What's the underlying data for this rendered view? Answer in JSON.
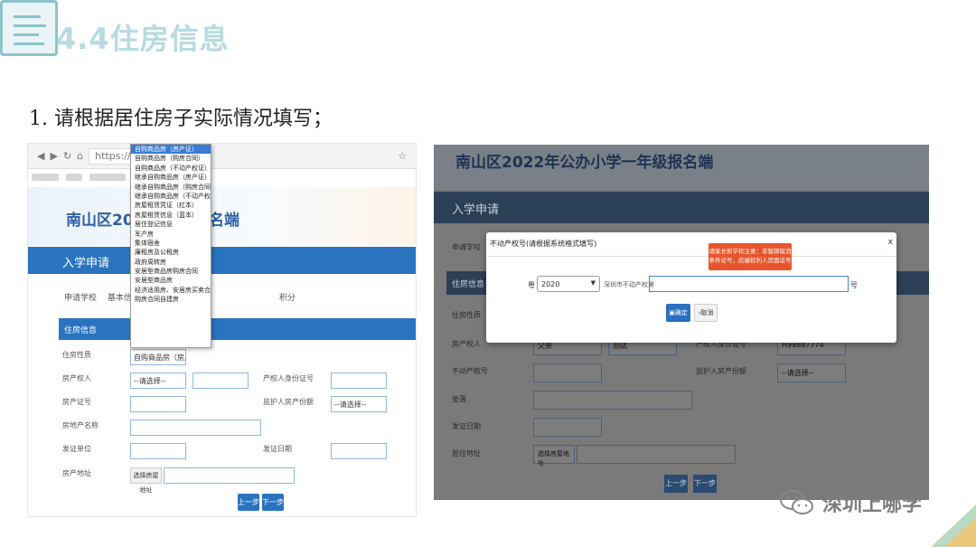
{
  "slide": {
    "title": "4.4住房信息",
    "instruction": "1. 请根据居住房子实际情况填写；",
    "brand": "深圳上哪学"
  },
  "left_shot": {
    "browser": {
      "url": "https://ns"
    },
    "banner_title": "南山区2022年",
    "banner_title_tail": "名端",
    "nav_title": "入学申请",
    "tabs": [
      "申请学校",
      "基本信息",
      "积分"
    ],
    "section_title": "住房信息",
    "labels": {
      "housing_type": "住房性质",
      "owner": "房产权人",
      "owner_id": "产权人身份证号",
      "cert_no": "房产证号",
      "guardian_share": "监护人房产份额",
      "property_name": "房地产名称",
      "issuer": "发证单位",
      "issue_date": "发证日期",
      "address": "房产地址"
    },
    "values": {
      "housing_type": "自购商品房（房产证）",
      "owner_select": "--请选择--",
      "guardian_select": "--请选择--",
      "address_button": "选择房屋地址"
    },
    "dropdown_options": [
      "自购商品房（房产证）",
      "自购商品房（购房合同）",
      "自购商品房（不动产权证）",
      "继承自购商品房（房产证）",
      "继承自购商品房（购房合同）",
      "继承自购商品房（不动产权证）",
      "房屋租赁凭证（红本）",
      "房屋租赁信息（蓝本）",
      "居住登记信息",
      "军产房",
      "集体宿舍",
      "廉租房及公租房",
      "政府周转房",
      "安居型商品房购房合同",
      "安居型商品房",
      "经济适用房、安居房买卖合同",
      "购房合同自建房"
    ],
    "buttons": {
      "prev": "上一步",
      "next": "下一步"
    }
  },
  "right_shot": {
    "banner_title": "南山区2022年公办小学一年级报名端",
    "nav_title": "入学申请",
    "tab": "申请学校",
    "section_title": "住房信息",
    "labels": {
      "housing_type": "住房性质",
      "owner": "房产权人",
      "cert_no": "不动产权号",
      "guardian_share": "监护人房产份额",
      "address_area": "坐落",
      "issue_date": "发证日期",
      "address": "居住地址"
    },
    "values": {
      "owner": "父亲",
      "owner_name": "测试",
      "owner_id_label": "产权人身份证号",
      "owner_id": "H99887774",
      "guardian_select": "--请选择--",
      "address_button": "选择房屋地址"
    },
    "buttons": {
      "prev": "上一步",
      "next": "下一步"
    },
    "modal": {
      "title": "不动产权号(请根据系统格式填写)",
      "close": "x",
      "prefix": "粤",
      "year": "2020",
      "city_text": "深圳市不动产权第",
      "suffix": "号",
      "tip": "请家长和学校注意：非暂牌取消条件证号，应被权利人页面证号",
      "confirm": "确定",
      "cancel": "取消"
    }
  },
  "colors": {
    "primary_blue": "#2a73bf",
    "tip_orange": "#e8552d",
    "title_teal": "#b7dbe1"
  }
}
